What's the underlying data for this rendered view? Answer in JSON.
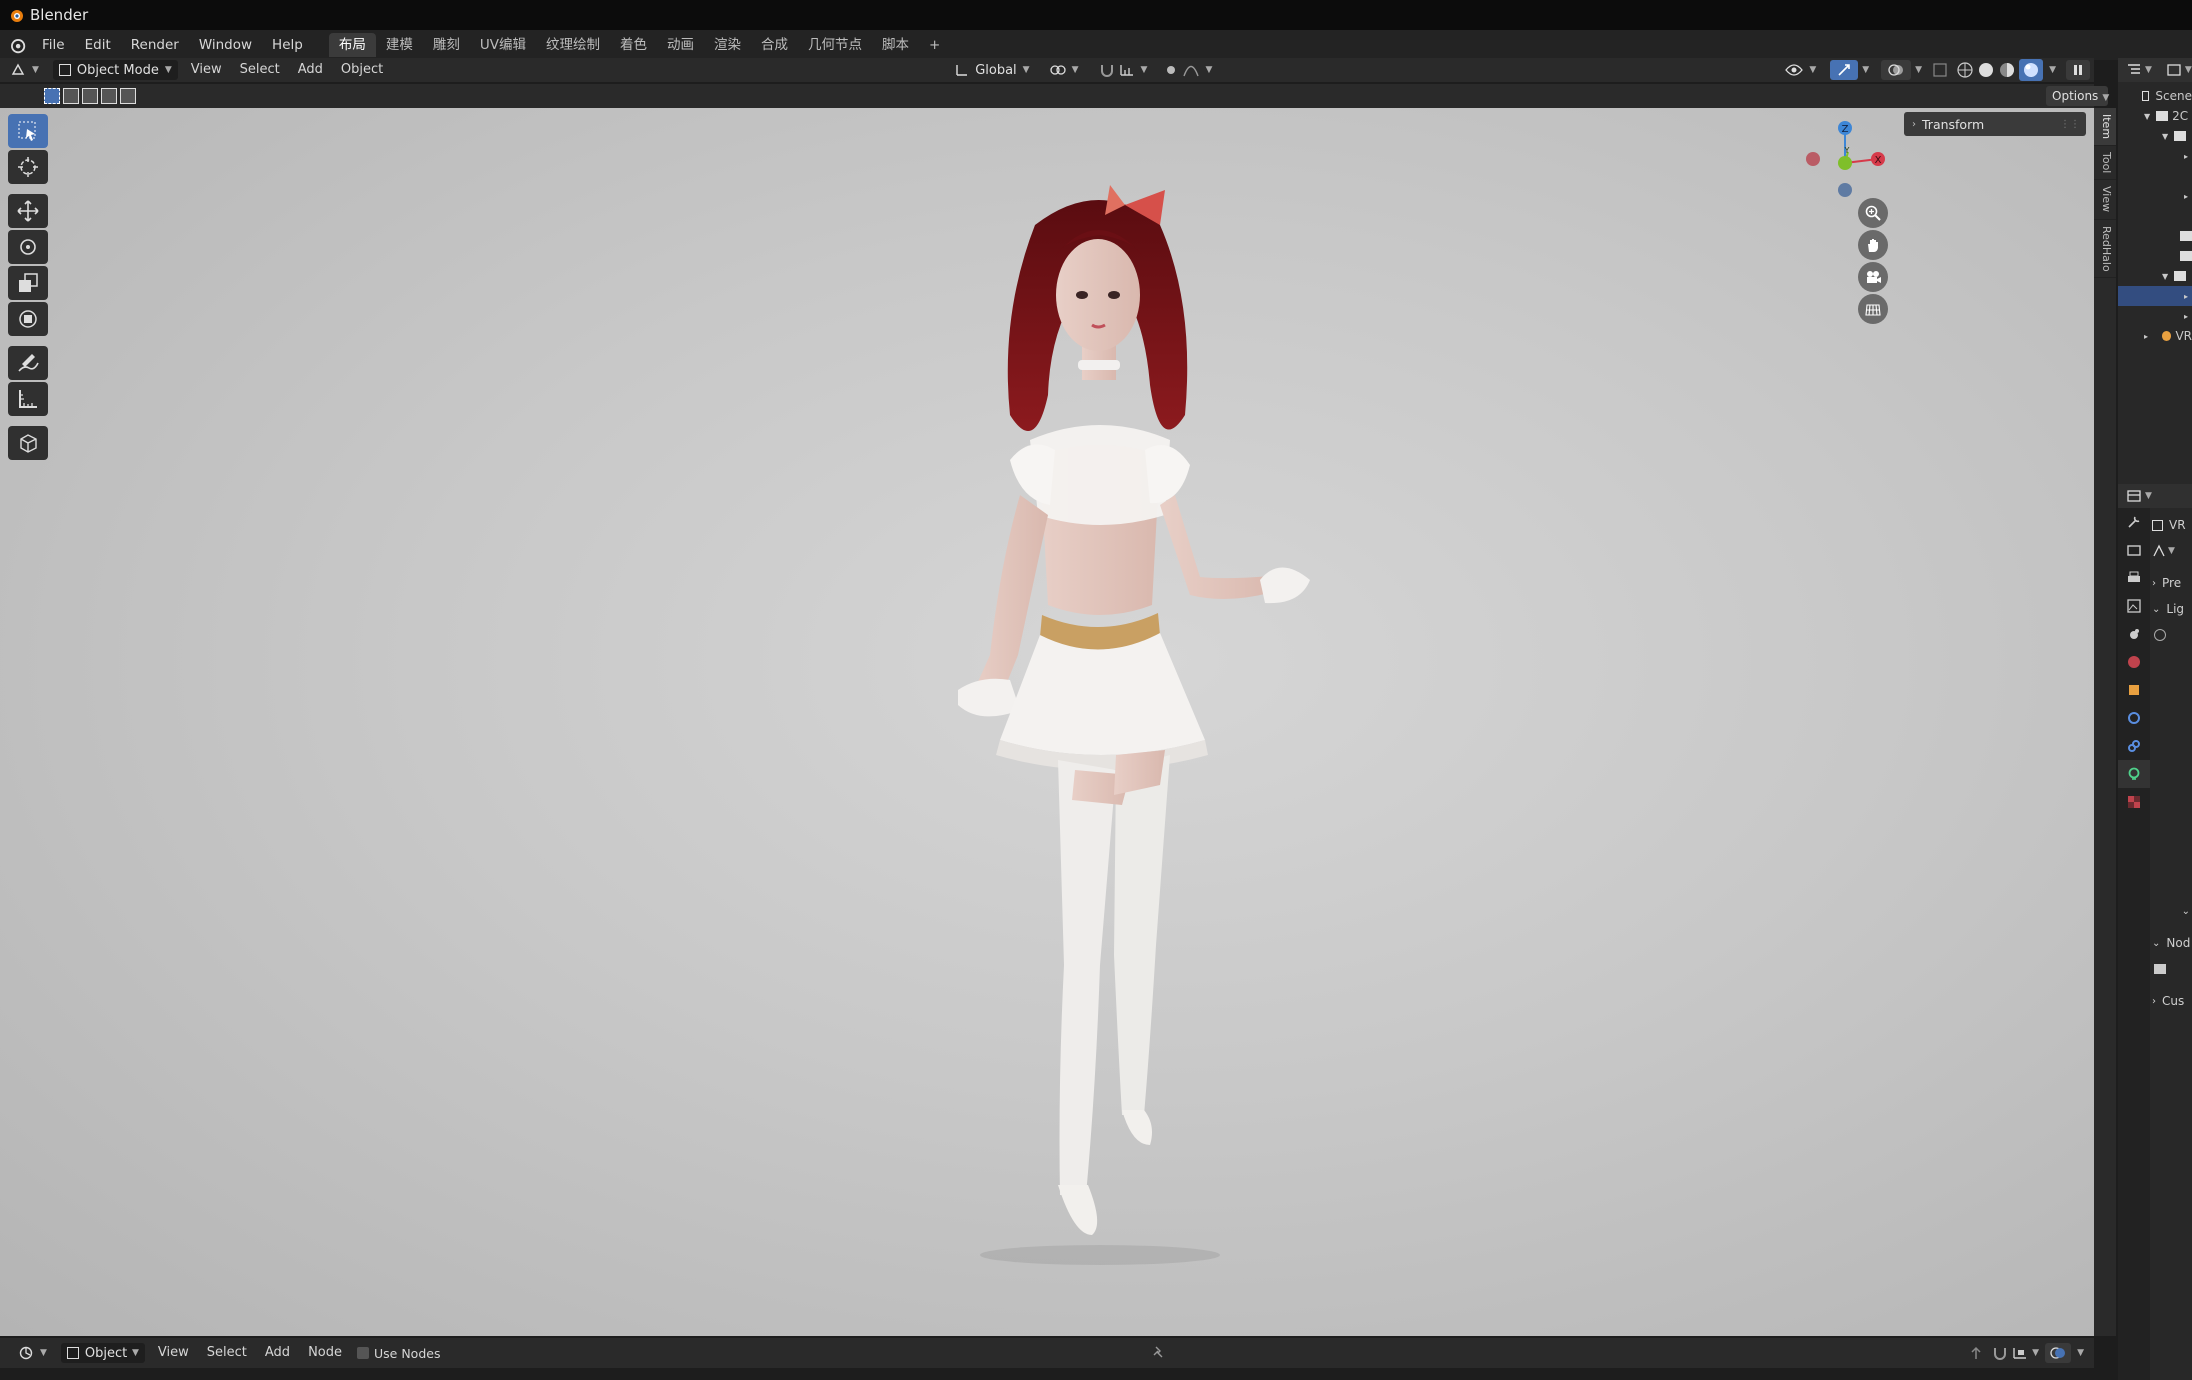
{
  "app": {
    "title": "Blender"
  },
  "menubar": {
    "menus": [
      "File",
      "Edit",
      "Render",
      "Window",
      "Help"
    ],
    "workspaces": [
      "布局",
      "建模",
      "雕刻",
      "UV编辑",
      "纹理绘制",
      "着色",
      "动画",
      "渲染",
      "合成",
      "几何节点",
      "脚本"
    ],
    "add_workspace": "+"
  },
  "viewport_header": {
    "mode": "Object Mode",
    "menus": [
      "View",
      "Select",
      "Add",
      "Object"
    ],
    "transform_orientation": "Global"
  },
  "viewport": {
    "options_label": "Options",
    "npanel_tabs": [
      "Item",
      "Tool",
      "View",
      "RedHalo"
    ],
    "transform_panel": "Transform",
    "gizmo": {
      "z": "Z",
      "x": "X",
      "y": "Y"
    },
    "colors": {
      "x_axis": "#d63a4a",
      "y_axis": "#7fbf2a",
      "z_axis": "#3d86d6"
    }
  },
  "node_header": {
    "mode": "Object",
    "menus": [
      "View",
      "Select",
      "Add",
      "Node"
    ],
    "use_nodes": "Use Nodes"
  },
  "outliner": {
    "header": "Scene",
    "rows": [
      "2C",
      "",
      "",
      "",
      "",
      "",
      "",
      "",
      "",
      "VR"
    ]
  },
  "properties": {
    "rows": [
      "VR",
      "",
      "Pre",
      "Lig",
      "",
      "",
      "",
      "Nod",
      "",
      "Cus"
    ]
  }
}
